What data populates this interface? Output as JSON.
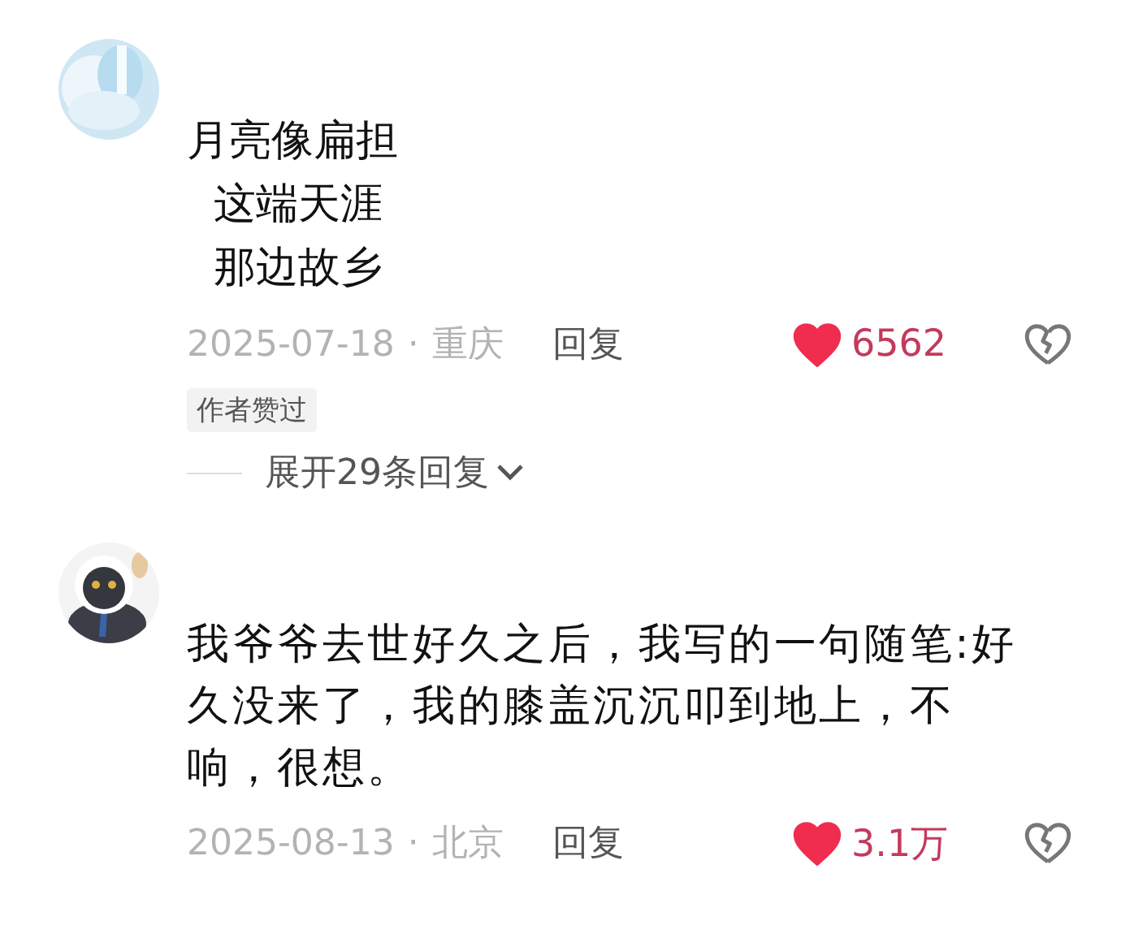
{
  "comments": [
    {
      "lines": [
        "月亮像扁担",
        "  这端天涯",
        "  那边故乡"
      ],
      "date": "2025-07-18",
      "separator": "·",
      "location": "重庆",
      "reply_label": "回复",
      "liked": true,
      "like_count": "6562",
      "badge": "作者赞过",
      "expand_label": "展开29条回复"
    },
    {
      "lines": [
        "我爷爷去世好久之后，我写的一句随笔:好久没来了，我的膝盖沉沉叩到地上，不响，很想。"
      ],
      "date": "2025-08-13",
      "separator": "·",
      "location": "北京",
      "reply_label": "回复",
      "liked": true,
      "like_count": "3.1万"
    }
  ]
}
